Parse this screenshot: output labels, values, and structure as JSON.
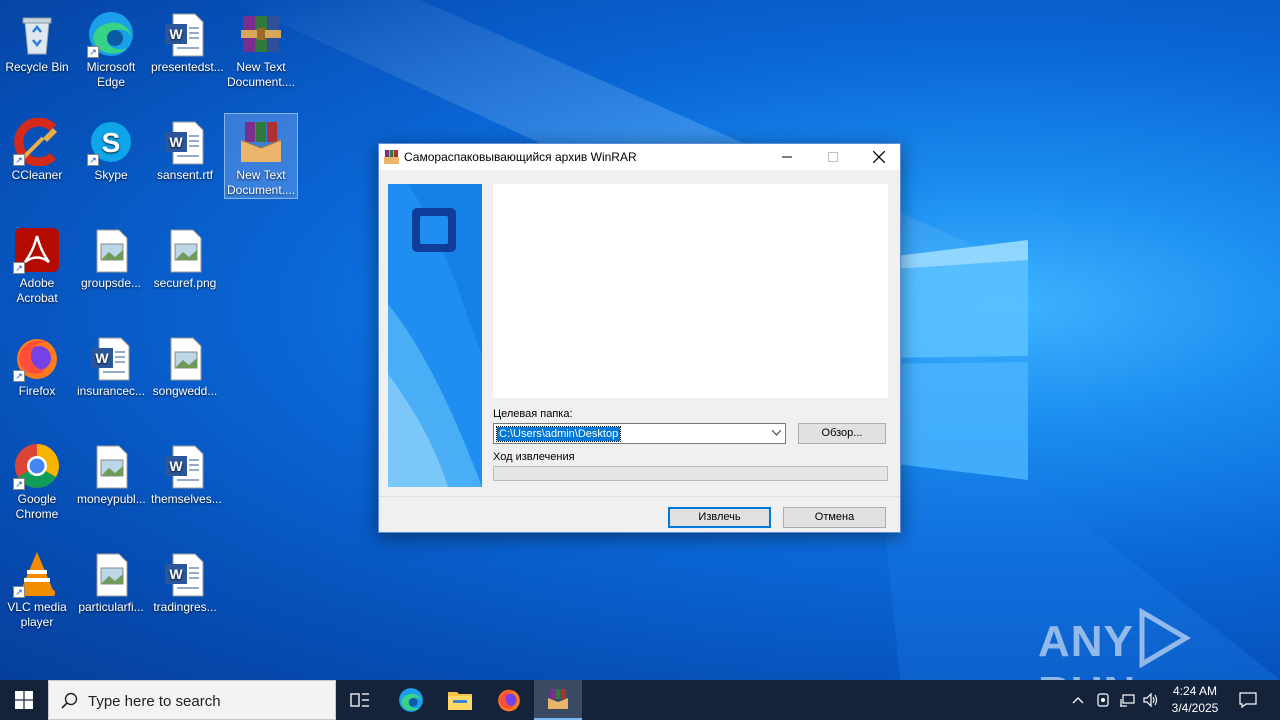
{
  "desktop": {
    "icons": [
      {
        "label": "Recycle Bin"
      },
      {
        "label": "Microsoft Edge"
      },
      {
        "label": "presentedst..."
      },
      {
        "label": "New Text Document...."
      },
      {
        "label": "CCleaner"
      },
      {
        "label": "Skype"
      },
      {
        "label": "sansent.rtf"
      },
      {
        "label": "New Text Document...."
      },
      {
        "label": "Adobe Acrobat"
      },
      {
        "label": "groupsde..."
      },
      {
        "label": "securef.png"
      },
      {
        "label": "Firefox"
      },
      {
        "label": "insurancec..."
      },
      {
        "label": "songwedd..."
      },
      {
        "label": "Google Chrome"
      },
      {
        "label": "moneypubl..."
      },
      {
        "label": "themselves..."
      },
      {
        "label": "VLC media player"
      },
      {
        "label": "particularfi..."
      },
      {
        "label": "tradingres..."
      }
    ]
  },
  "dialog": {
    "title": "Самораспаковывающийся архив WinRAR",
    "dest_label": "Целевая папка:",
    "dest_value": "C:\\Users\\admin\\Desktop",
    "browse_label": "Обзор...",
    "progress_label": "Ход извлечения",
    "progress_value": 0,
    "extract_label": "Извлечь",
    "cancel_label": "Отмена"
  },
  "watermark": {
    "left": "ANY",
    "right": "RUN"
  },
  "taskbar": {
    "search_placeholder": "Type here to search",
    "time": "4:24 AM",
    "date": "3/4/2025"
  },
  "colors": {
    "accent": "#0078d7",
    "taskbar": "#15233a",
    "desktop": "#0a5fc8"
  }
}
